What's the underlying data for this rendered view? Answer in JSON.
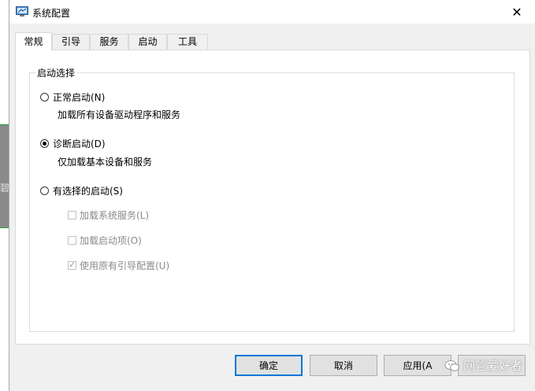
{
  "window": {
    "title": "系统配置",
    "close_glyph": "✕"
  },
  "tabs": [
    {
      "label": "常规",
      "active": true
    },
    {
      "label": "引导",
      "active": false
    },
    {
      "label": "服务",
      "active": false
    },
    {
      "label": "启动",
      "active": false
    },
    {
      "label": "工具",
      "active": false
    }
  ],
  "startup": {
    "group_label": "启动选择",
    "options": [
      {
        "label": "正常启动(N)",
        "description": "加载所有设备驱动程序和服务",
        "checked": false
      },
      {
        "label": "诊断启动(D)",
        "description": "仅加载基本设备和服务",
        "checked": true
      },
      {
        "label": "有选择的启动(S)",
        "checked": false
      }
    ],
    "selective_items": [
      {
        "label": "加载系统服务(L)",
        "checked": false,
        "disabled": true
      },
      {
        "label": "加载启动项(O)",
        "checked": false,
        "disabled": true
      },
      {
        "label": "使用原有引导配置(U)",
        "checked": true,
        "disabled": true
      }
    ]
  },
  "buttons": {
    "ok": "确定",
    "cancel": "取消",
    "apply": "应用(A"
  },
  "watermark": "网管爱好者",
  "background_glyph": "碧",
  "colors": {
    "accent": "#0078d7",
    "background_line": "#1f9d3d"
  }
}
